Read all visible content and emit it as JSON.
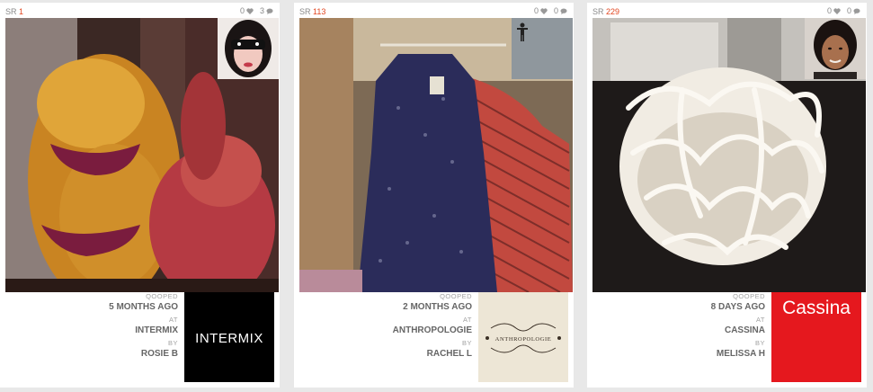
{
  "cards": [
    {
      "sr_label": "SR",
      "sr_number": "1",
      "likes": "0",
      "comments": "3",
      "qooped_label": "QOOPED",
      "time": "5 MONTHS AGO",
      "at_label": "AT",
      "store": "INTERMIX",
      "by_label": "BY",
      "user": "ROSIE B",
      "logo_text": "INTERMIX"
    },
    {
      "sr_label": "SR",
      "sr_number": "113",
      "likes": "0",
      "comments": "0",
      "qooped_label": "QOOPED",
      "time": "2 MONTHS AGO",
      "at_label": "AT",
      "store": "ANTHROPOLOGIE",
      "by_label": "BY",
      "user": "RACHEL L",
      "logo_text": "ANTHROPOLOGIE"
    },
    {
      "sr_label": "SR",
      "sr_number": "229",
      "likes": "0",
      "comments": "0",
      "qooped_label": "QOOPED",
      "time": "8 DAYS AGO",
      "at_label": "AT",
      "store": "CASSINA",
      "by_label": "BY",
      "user": "MELISSA H",
      "logo_text": "Cassina"
    }
  ],
  "icons": {
    "like": "heart-icon",
    "comment": "comment-bubble-icon",
    "default_avatar": "person-silhouette-icon"
  },
  "colors": {
    "sr_number": "#e2451f",
    "cassina_red": "#e5181e",
    "meta_text": "#666666"
  }
}
